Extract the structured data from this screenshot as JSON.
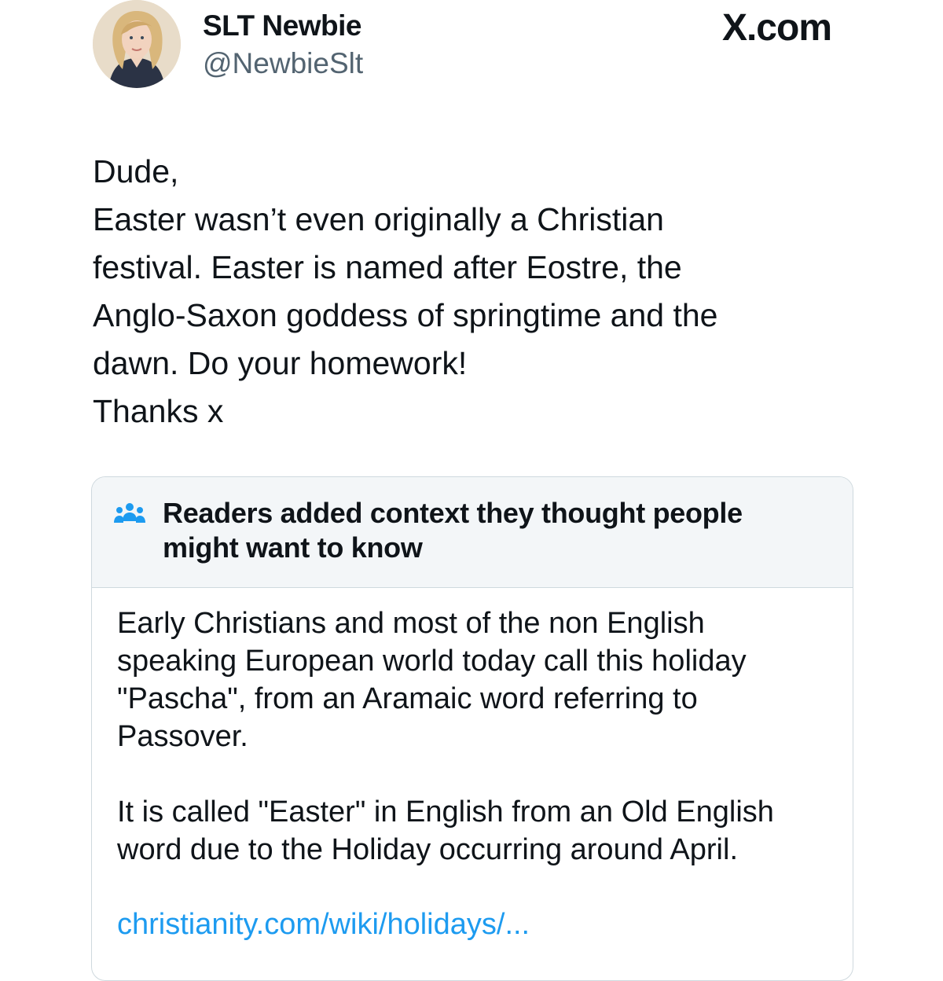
{
  "author": {
    "display_name": "SLT Newbie",
    "handle": "@NewbieSlt",
    "avatar_icon": "profile-photo"
  },
  "brand": {
    "label": "X.com"
  },
  "tweet": {
    "lines": [
      "Dude,",
      "Easter wasn’t even originally a Christian",
      "festival. Easter is named after Eostre, the",
      "Anglo-Saxon goddess of springtime and the",
      "dawn. Do your homework!",
      "Thanks x"
    ]
  },
  "community_note": {
    "icon": "people-group-icon",
    "accent_color": "#1d9bf0",
    "header_lines": [
      "Readers added context they thought people",
      "might want to know"
    ],
    "paragraph_1": [
      "Early Christians and most of the non English",
      "speaking European world today call this holiday",
      "\"Pascha\", from an Aramaic word referring to",
      "Passover."
    ],
    "paragraph_2": [
      "It is called \"Easter\" in English from an Old English",
      "word due to the Holiday occurring around April."
    ],
    "link": "christianity.com/wiki/holidays/..."
  }
}
